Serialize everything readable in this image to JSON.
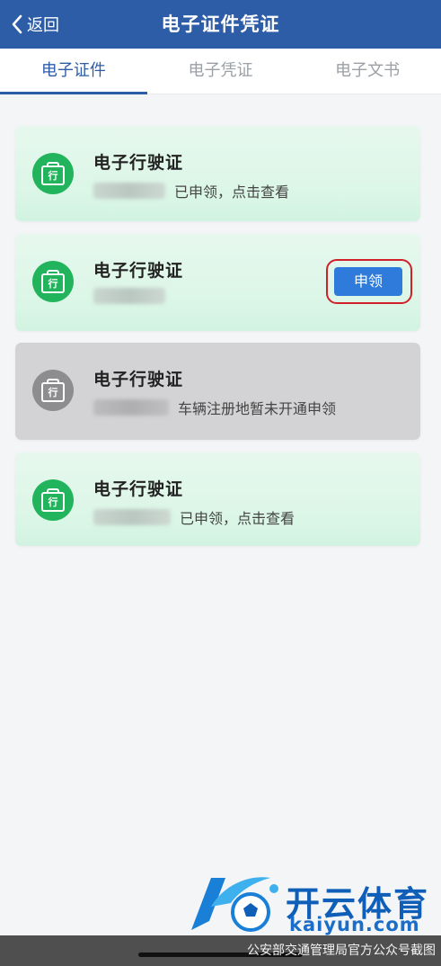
{
  "nav": {
    "back_label": "返回",
    "title": "电子证件凭证"
  },
  "tabs": [
    {
      "label": "电子证件",
      "active": true
    },
    {
      "label": "电子凭证",
      "active": false
    },
    {
      "label": "电子文书",
      "active": false
    }
  ],
  "cards": [
    {
      "badge": "行",
      "title": "电子行驶证",
      "status": "已申领，点击查看",
      "plate_obscured": true,
      "state": "claimed"
    },
    {
      "badge": "行",
      "title": "电子行驶证",
      "status": "",
      "plate_obscured": true,
      "state": "claimable",
      "button_label": "申领"
    },
    {
      "badge": "行",
      "title": "电子行驶证",
      "status": "车辆注册地暂未开通申领",
      "plate_obscured": true,
      "state": "unavailable"
    },
    {
      "badge": "行",
      "title": "电子行驶证",
      "status": "已申领，点击查看",
      "plate_obscured": true,
      "state": "claimed"
    }
  ],
  "watermark": {
    "brand_cn": "开云体育",
    "brand_en": "kaiyun.com",
    "credit": "公安部交通管理局官方公众号截图"
  },
  "colors": {
    "nav_bg": "#2e5da8",
    "active_tab": "#2e5da8",
    "badge_green": "#22b45c",
    "badge_gray": "#8d8d8f",
    "button_blue": "#2f7bdb",
    "highlight_red": "#d0212a"
  }
}
